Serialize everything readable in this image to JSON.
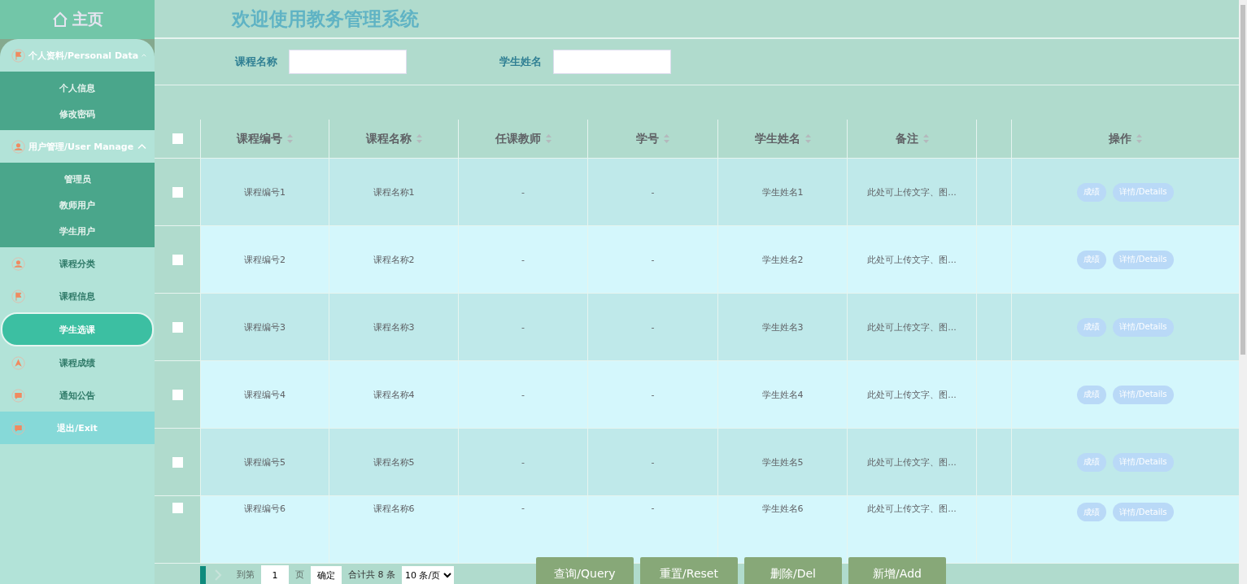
{
  "sidebar": {
    "home": "主页",
    "items": [
      {
        "kind": "group",
        "label": "个人资料/Personal Data",
        "expanded": true,
        "children": [
          {
            "label": "个人信息",
            "selected": false
          },
          {
            "label": "修改密码",
            "selected": false
          }
        ]
      },
      {
        "kind": "group",
        "label": "用户管理/User Manage",
        "expanded": true,
        "children": [
          {
            "label": "管理员",
            "selected": false
          },
          {
            "label": "教师用户",
            "selected": false
          },
          {
            "label": "学生用户",
            "selected": false
          }
        ]
      },
      {
        "kind": "item",
        "label": "课程分类",
        "selected": false
      },
      {
        "kind": "item",
        "label": "课程信息",
        "selected": false
      },
      {
        "kind": "item",
        "label": "学生选课",
        "selected": true
      },
      {
        "kind": "item",
        "label": "课程成绩",
        "selected": false
      },
      {
        "kind": "item",
        "label": "通知公告",
        "selected": false
      },
      {
        "kind": "exit",
        "label": "退出/Exit",
        "selected": false
      }
    ]
  },
  "title": "欢迎使用教务管理系统",
  "search": [
    {
      "label": "课程名称"
    },
    {
      "label": "学生姓名"
    }
  ],
  "table": {
    "header_checkbox": {
      "checked": false
    },
    "columns": [
      "课程编号",
      "课程名称",
      "任课教师",
      "学号",
      "学生姓名",
      "备注",
      "",
      "操作"
    ],
    "rows": [
      {
        "checked": false,
        "cells": [
          "课程编号1",
          "课程名称1",
          "-",
          "-",
          "学生姓名1",
          "此处可上传文字、图..."
        ],
        "actions": [
          "成绩",
          "详情/Details"
        ]
      },
      {
        "checked": false,
        "cells": [
          "课程编号2",
          "课程名称2",
          "-",
          "-",
          "学生姓名2",
          "此处可上传文字、图..."
        ],
        "actions": [
          "成绩",
          "详情/Details"
        ]
      },
      {
        "checked": false,
        "cells": [
          "课程编号3",
          "课程名称3",
          "-",
          "-",
          "学生姓名3",
          "此处可上传文字、图..."
        ],
        "actions": [
          "成绩",
          "详情/Details"
        ]
      },
      {
        "checked": false,
        "cells": [
          "课程编号4",
          "课程名称4",
          "-",
          "-",
          "学生姓名4",
          "此处可上传文字、图..."
        ],
        "actions": [
          "成绩",
          "详情/Details"
        ]
      },
      {
        "checked": false,
        "cells": [
          "课程编号5",
          "课程名称5",
          "-",
          "-",
          "学生姓名5",
          "此处可上传文字、图..."
        ],
        "actions": [
          "成绩",
          "详情/Details"
        ]
      },
      {
        "checked": false,
        "cells": [
          "课程编号6",
          "课程名称6",
          "-",
          "-",
          "学生姓名6",
          "此处可上传文字、图..."
        ],
        "actions": [
          "成绩",
          "详情/Details"
        ]
      }
    ]
  },
  "pager": {
    "goto_label": "到第",
    "page": "1",
    "page_unit": "页",
    "confirm": "确定",
    "total": "合计共 8 条",
    "page_size": "10 条/页"
  },
  "buttons": [
    "查询/Query",
    "重置/Reset",
    "删除/Del",
    "新增/Add"
  ]
}
